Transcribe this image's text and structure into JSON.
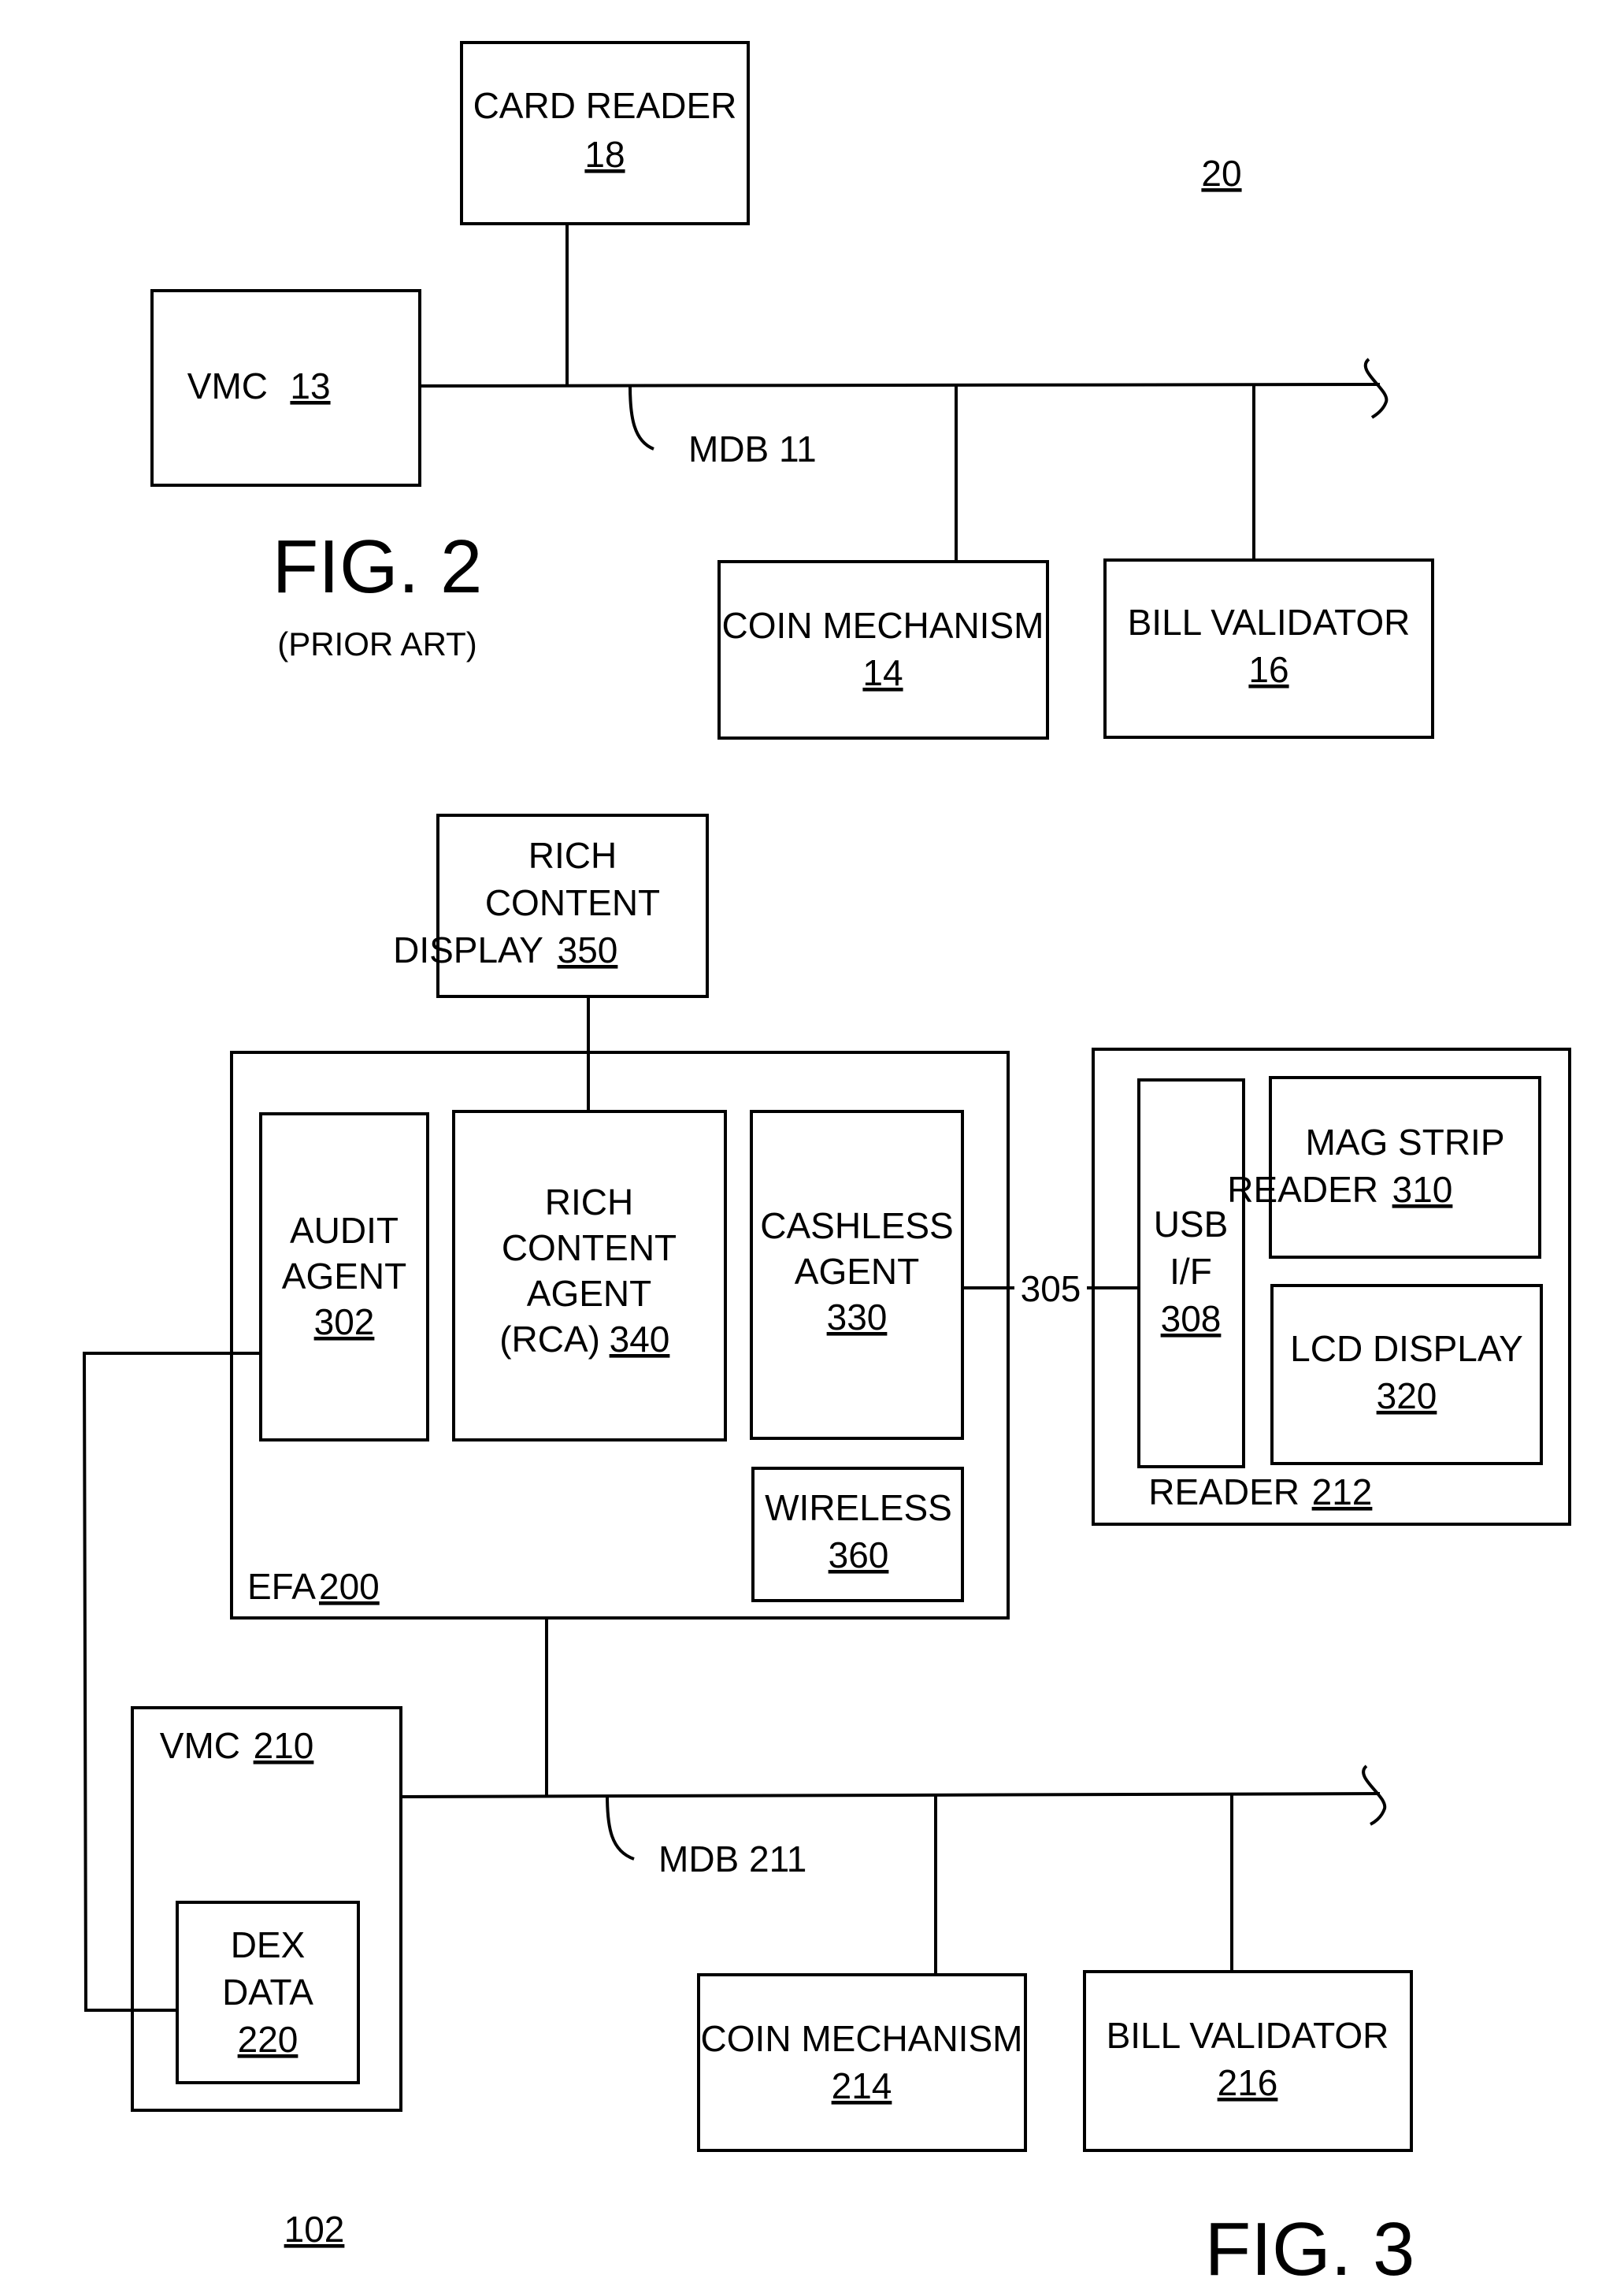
{
  "fig2": {
    "title": "FIG. 2",
    "subtitle": "(PRIOR ART)",
    "ref": "20",
    "card_reader": {
      "label": "CARD READER",
      "ref": "18"
    },
    "vmc": {
      "label": "VMC",
      "ref": "13"
    },
    "bus": {
      "label": "MDB 11"
    },
    "coin_mechanism": {
      "label": "COIN MECHANISM",
      "ref": "14"
    },
    "bill_validator": {
      "label": "BILL VALIDATOR",
      "ref": "16"
    }
  },
  "fig3": {
    "title": "FIG. 3",
    "ref": "102",
    "rich_content_display": {
      "line1": "RICH",
      "line2": "CONTENT",
      "line3": "DISPLAY",
      "ref": "350"
    },
    "efa": {
      "label": "EFA",
      "ref": "200"
    },
    "audit_agent": {
      "line1": "AUDIT",
      "line2": "AGENT",
      "ref": "302"
    },
    "rca": {
      "line1": "RICH",
      "line2": "CONTENT",
      "line3": "AGENT",
      "line4": "(RCA)",
      "ref": "340"
    },
    "cashless_agent": {
      "line1": "CASHLESS",
      "line2": "AGENT",
      "ref": "330"
    },
    "wireless": {
      "label": "WIRELESS",
      "ref": "360"
    },
    "link": {
      "label": "305"
    },
    "reader": {
      "label": "READER",
      "ref": "212"
    },
    "usb_if": {
      "line1": "USB",
      "line2": "I/F",
      "ref": "308"
    },
    "mag_strip_reader": {
      "line1": "MAG STRIP",
      "line2": "READER",
      "ref": "310"
    },
    "lcd_display": {
      "label": "LCD DISPLAY",
      "ref": "320"
    },
    "vmc": {
      "label": "VMC",
      "ref": "210"
    },
    "dex_data": {
      "line1": "DEX",
      "line2": "DATA",
      "ref": "220"
    },
    "bus": {
      "label": "MDB 211"
    },
    "coin_mechanism": {
      "label": "COIN MECHANISM",
      "ref": "214"
    },
    "bill_validator": {
      "label": "BILL VALIDATOR",
      "ref": "216"
    }
  }
}
